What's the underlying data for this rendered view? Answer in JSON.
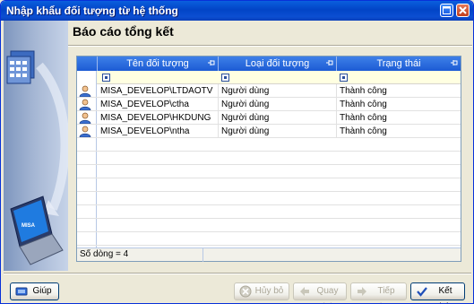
{
  "window": {
    "title": "Nhập khẩu đối tượng từ hệ thống"
  },
  "section": {
    "title": "Báo cáo tổng kết"
  },
  "grid": {
    "columns": [
      "Tên đối tượng",
      "Loại đối tượng",
      "Trạng thái"
    ],
    "rows": [
      {
        "name": "MISA_DEVELOP\\LTDAOTV",
        "type": "Người dùng",
        "status": "Thành công",
        "icon": "user-icon"
      },
      {
        "name": "MISA_DEVELOP\\ctha",
        "type": "Người dùng",
        "status": "Thành công",
        "icon": "user-icon"
      },
      {
        "name": "MISA_DEVELOP\\HKDUNG",
        "type": "Người dùng",
        "status": "Thành công",
        "icon": "user-icon"
      },
      {
        "name": "MISA_DEVELOP\\ntha",
        "type": "Người dùng",
        "status": "Thành công",
        "icon": "user-icon"
      }
    ],
    "status": "Số dòng = 4"
  },
  "side_graphic": {
    "brand": "MISA"
  },
  "buttons": {
    "help": "Giúp",
    "cancel": "Hủy bỏ",
    "back": "Quay lại",
    "next": "Tiếp theo",
    "finish": "Kết thúc"
  },
  "colors": {
    "titlebar": "#0A5FDE",
    "grid_header": "#3E80E8",
    "filter_row": "#FFFFE1"
  }
}
